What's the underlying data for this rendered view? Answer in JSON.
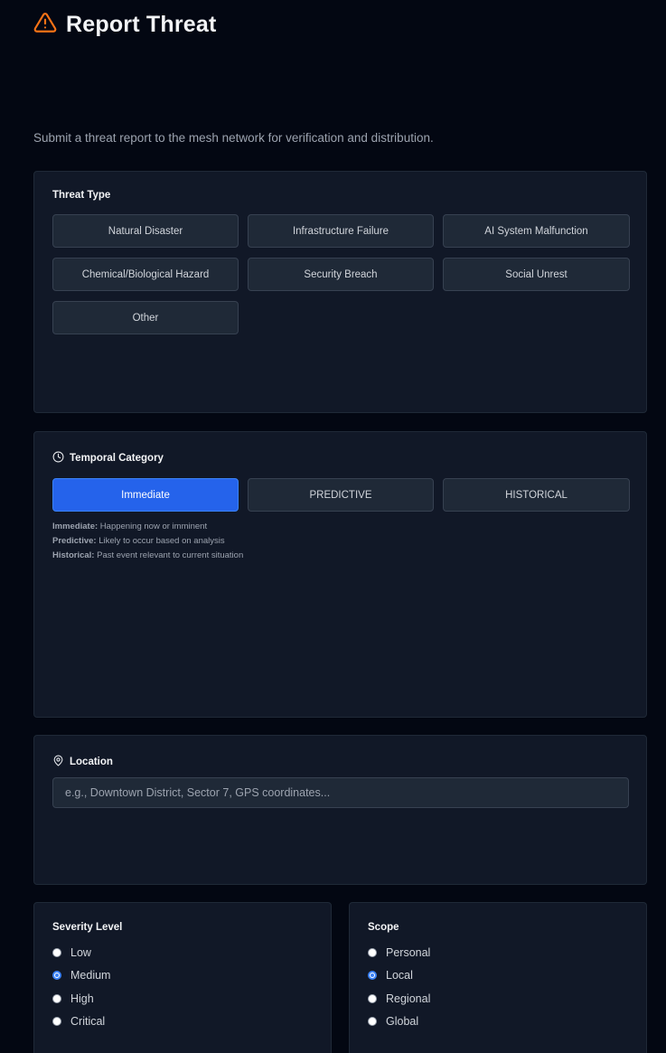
{
  "page": {
    "title": "Report Threat",
    "icon": "warning-triangle-icon",
    "subtitle": "Submit a threat report to the mesh network for verification and distribution."
  },
  "threat_type": {
    "label": "Threat Type",
    "options": [
      "Natural Disaster",
      "Infrastructure Failure",
      "AI System Malfunction",
      "Chemical/Biological Hazard",
      "Security Breach",
      "Social Unrest",
      "Other"
    ]
  },
  "temporal": {
    "label": "Temporal Category",
    "icon": "clock-icon",
    "options": [
      "Immediate",
      "PREDICTIVE",
      "HISTORICAL"
    ],
    "selected": "Immediate",
    "legend": [
      {
        "term": "Immediate:",
        "desc": " Happening now or imminent"
      },
      {
        "term": "Predictive:",
        "desc": " Likely to occur based on analysis"
      },
      {
        "term": "Historical:",
        "desc": " Past event relevant to current situation"
      }
    ]
  },
  "location": {
    "label": "Location",
    "icon": "map-pin-icon",
    "placeholder": "e.g., Downtown District, Sector 7, GPS coordinates...",
    "value": ""
  },
  "severity": {
    "label": "Severity Level",
    "options": [
      "Low",
      "Medium",
      "High",
      "Critical"
    ],
    "selected": "Medium"
  },
  "scope": {
    "label": "Scope",
    "options": [
      "Personal",
      "Local",
      "Regional",
      "Global"
    ],
    "selected": "Local"
  },
  "colors": {
    "background": "#030712",
    "card": "#111827",
    "accent": "#2563eb",
    "warning": "#f97316"
  }
}
